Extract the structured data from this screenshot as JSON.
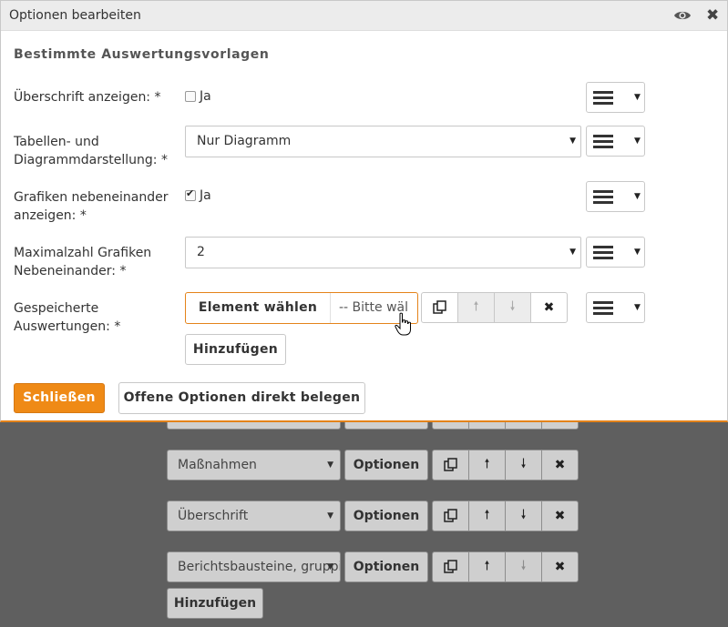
{
  "dialog": {
    "title": "Optionen bearbeiten",
    "section_title": "Bestimmte Auswertungsvorlagen",
    "fields": {
      "ueberschrift": {
        "label": "Überschrift anzeigen: *",
        "checkbox_label": "Ja",
        "checked": false
      },
      "tabellen": {
        "label": "Tabellen- und Diagrammdarstellung: *",
        "value": "Nur Diagramm"
      },
      "grafiken": {
        "label": "Grafiken nebeneinander anzeigen: *",
        "checkbox_label": "Ja",
        "checked": true
      },
      "maxzahl": {
        "label": "Maximalzahl Grafiken Nebeneinander: *",
        "value": "2"
      },
      "gespeichert": {
        "label": "Gespeicherte Auswertungen: *",
        "element_button": "Element wählen",
        "select_value": "-- Bitte wäl",
        "add_label": "Hinzufügen"
      }
    },
    "footer": {
      "close_label": "Schließen",
      "offene_label": "Offene Optionen direkt belegen"
    }
  },
  "background": {
    "rows": [
      {
        "select": "Maßnahmen",
        "options_label": "Optionen"
      },
      {
        "select": "Überschrift",
        "options_label": "Optionen"
      },
      {
        "select": "Berichtsbausteine, gruppi",
        "options_label": "Optionen"
      }
    ],
    "add_label": "Hinzufügen"
  },
  "colors": {
    "accent": "#ef8a16",
    "overlay": "#5f5f5f"
  },
  "icons": [
    "eye-icon",
    "close-icon",
    "menu-icon",
    "copy-icon",
    "arrow-up-icon",
    "arrow-down-icon",
    "delete-icon",
    "hand-cursor-icon"
  ]
}
